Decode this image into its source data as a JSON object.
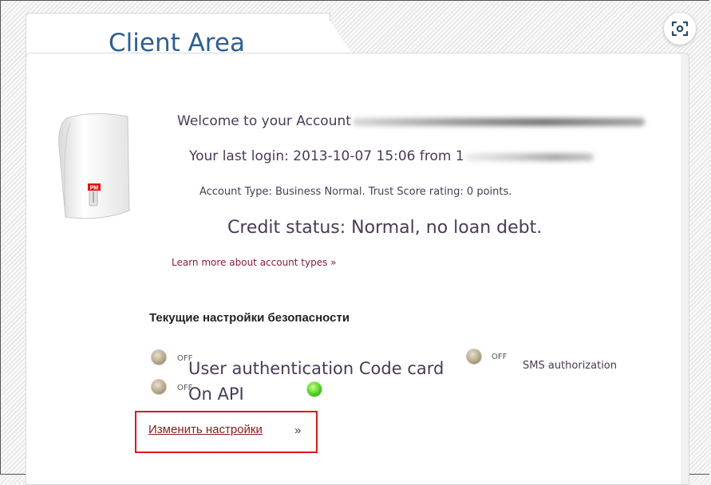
{
  "header": {
    "title": "Client Area"
  },
  "account": {
    "welcome": "Welcome to your Account",
    "last_login": "Your last login: 2013-10-07 15:06 from 1",
    "account_type": "Account Type: Business Normal. Trust Score rating: 0 points.",
    "credit_status": "Credit status: Normal, no loan debt.",
    "learn_more": "Learn more about account types »"
  },
  "terminal": {
    "badge": "PM",
    "icon": "payment-terminal-icon"
  },
  "security": {
    "heading": "Текущие настройки безопасности",
    "items": [
      {
        "state": "OFF",
        "label": "User authentication Code card",
        "status": "off"
      },
      {
        "state": "OFF",
        "label": "SMS authorization",
        "status": "off"
      },
      {
        "state": "OFF",
        "label": "On API",
        "status": "on"
      }
    ],
    "change_link": "Изменить настройки",
    "change_suffix": "»"
  },
  "toolbar": {
    "scan_icon": "scan-icon"
  },
  "colors": {
    "title": "#2d5f93",
    "link": "#8b1a3b",
    "highlight": "#e0161c",
    "led_on": "#4fd21f"
  }
}
